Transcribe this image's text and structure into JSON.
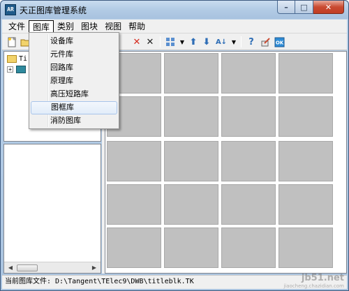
{
  "window": {
    "title": "天正图库管理系统",
    "app_icon_text": "AR",
    "min_label": "–",
    "max_label": "□",
    "close_label": "✕"
  },
  "menubar": {
    "items": [
      "文件",
      "图库",
      "类别",
      "图块",
      "视图",
      "帮助"
    ]
  },
  "dropdown": {
    "items": [
      "设备库",
      "元件库",
      "回路库",
      "原理库",
      "高压短路库",
      "图框库",
      "消防图库"
    ],
    "highlighted": "图框库"
  },
  "toolbar": {
    "icons": [
      "new-icon",
      "open-icon",
      "save-icon",
      "delete-red-icon",
      "delete-black-icon",
      "view-grid-icon",
      "dropdown-arrow-icon",
      "move-up-icon",
      "move-down-icon",
      "sort-icon",
      "dropdown-arrow-icon",
      "help-icon",
      "edit-icon",
      "ok-icon"
    ]
  },
  "tree": {
    "root_label": "Ti",
    "child_label": ""
  },
  "statusbar": {
    "text": "当前图库文件: D:\\Tangent\\TElec9\\DWB\\titleblk.TK"
  },
  "watermark": {
    "text": "jb51.net",
    "sub": "jiaocheng.chazidian.com"
  },
  "colors": {
    "cell_fill": "#c0c0c0",
    "close_button": "#c94a31",
    "accent_blue": "#2f6eb6"
  }
}
